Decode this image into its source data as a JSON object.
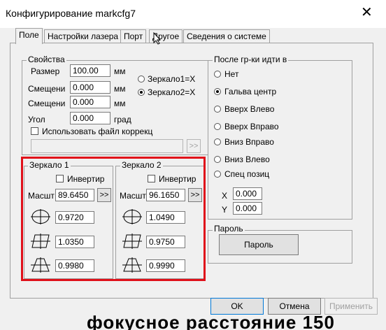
{
  "window": {
    "title": "Конфигурирование markcfg7",
    "close": "✕"
  },
  "tabs": [
    {
      "label": "Поле",
      "active": true
    },
    {
      "label": "Настройки лазера"
    },
    {
      "label": "Порт"
    },
    {
      "label": "Другое"
    },
    {
      "label": "Сведения о системе"
    }
  ],
  "properties": {
    "title": "Свойства",
    "size_label": "Размер",
    "size_value": "100.00",
    "size_unit": "мм",
    "offset1_label": "Смещени",
    "offset1_value": "0.000",
    "offset1_unit": "мм",
    "offset2_label": "Смещени",
    "offset2_value": "0.000",
    "offset2_unit": "мм",
    "angle_label": "Угол",
    "angle_value": "0.000",
    "angle_unit": "град",
    "mirror1_label": "Зеркало1=X",
    "mirror2_label": "Зеркало2=X",
    "use_correction_label": "Использовать файл коррекц",
    "browse_label": ">>"
  },
  "mirror1": {
    "title": "Зеркало 1",
    "invert_label": "Инвертир",
    "scale_label": "Масшт",
    "scale_value": "89.6450",
    "browse_label": ">>",
    "v1": "0.9720",
    "v2": "1.0350",
    "v3": "0.9980"
  },
  "mirror2": {
    "title": "Зеркало 2",
    "invert_label": "Инвертир",
    "scale_label": "Масшт",
    "scale_value": "96.1650",
    "browse_label": ">>",
    "v1": "1.0490",
    "v2": "0.9750",
    "v3": "0.9990"
  },
  "after_marking": {
    "title": "После гр-ки идти в",
    "options": [
      "Нет",
      "Гальва центр",
      "Вверх Влево",
      "Вверх Вправо",
      "Вниз Вправо",
      "Вниз Влево",
      "Спец позиц"
    ],
    "selected": "Гальва центр",
    "x_label": "X",
    "x_value": "0.000",
    "y_label": "Y",
    "y_value": "0.000"
  },
  "password": {
    "title": "Пароль",
    "button": "Пароль"
  },
  "footer": {
    "ok": "OK",
    "cancel": "Отмена",
    "apply": "Применить"
  },
  "overlay_text": "фокусное расстояние 150",
  "colors": {
    "highlight": "#e0101a",
    "window_bg": "#f0f0f0"
  }
}
